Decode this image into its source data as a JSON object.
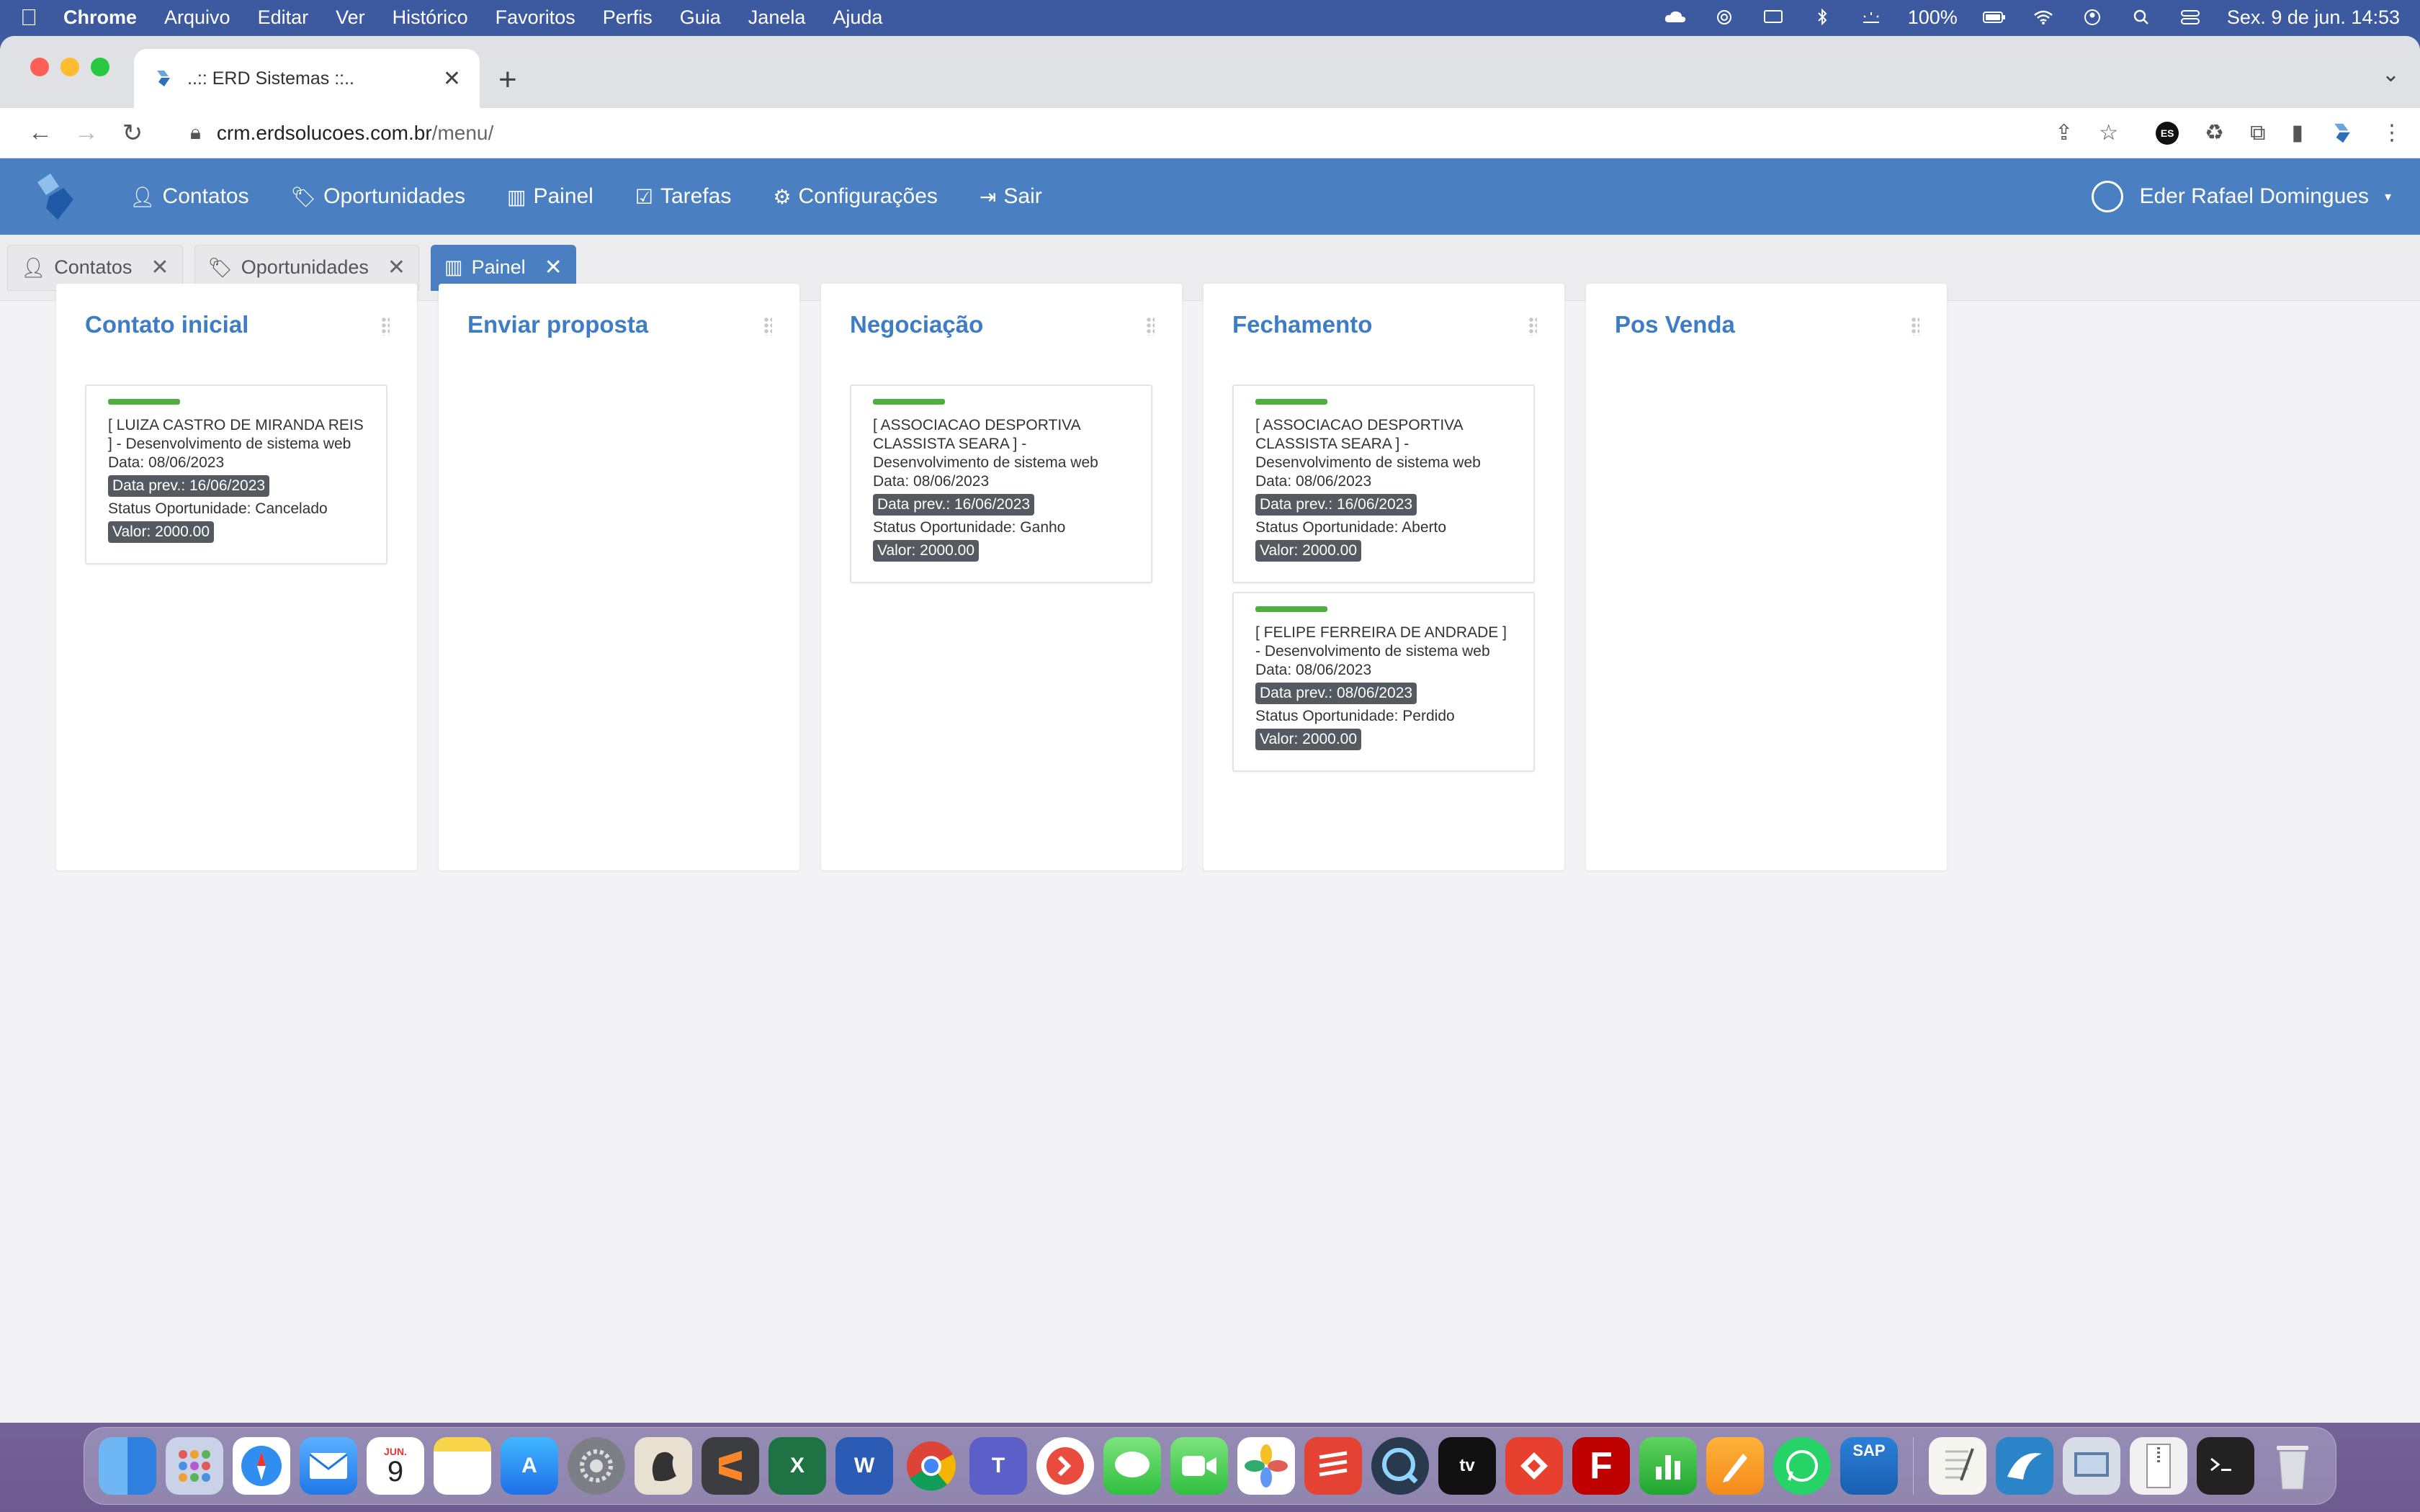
{
  "menubar": {
    "app_name": "Chrome",
    "items": [
      "Arquivo",
      "Editar",
      "Ver",
      "Histórico",
      "Favoritos",
      "Perfis",
      "Guia",
      "Janela",
      "Ajuda"
    ],
    "battery": "100%",
    "datetime": "Sex. 9 de jun.  14:53"
  },
  "browser": {
    "tab_title": "..:: ERD Sistemas ::..",
    "url_host": "crm.erdsolucoes.com.br",
    "url_path": "/menu/",
    "extension_es": "ES"
  },
  "app_nav": {
    "links": [
      "Contatos",
      "Oportunidades",
      "Painel",
      "Tarefas",
      "Configurações",
      "Sair"
    ],
    "user": "Eder Rafael Domingues"
  },
  "app_tabs": [
    {
      "label": "Contatos"
    },
    {
      "label": "Oportunidades"
    },
    {
      "label": "Painel"
    }
  ],
  "board": {
    "columns": [
      {
        "title": "Contato inicial",
        "cards": [
          {
            "title": "[ LUIZA CASTRO DE MIRANDA REIS ] - Desenvolvimento de sistema web",
            "date": "Data: 08/06/2023",
            "prev": "Data prev.: 16/06/2023",
            "status": "Status Oportunidade: Cancelado",
            "value": "Valor: 2000.00"
          }
        ]
      },
      {
        "title": "Enviar proposta",
        "cards": []
      },
      {
        "title": "Negociação",
        "cards": [
          {
            "title": "[ ASSOCIACAO DESPORTIVA CLASSISTA SEARA ] - Desenvolvimento de sistema web",
            "date": "Data: 08/06/2023",
            "prev": "Data prev.: 16/06/2023",
            "status": "Status Oportunidade: Ganho",
            "value": "Valor: 2000.00"
          }
        ]
      },
      {
        "title": "Fechamento",
        "cards": [
          {
            "title": "[ ASSOCIACAO DESPORTIVA CLASSISTA SEARA ] - Desenvolvimento de sistema web",
            "date": "Data: 08/06/2023",
            "prev": "Data prev.: 16/06/2023",
            "status": "Status Oportunidade: Aberto",
            "value": "Valor: 2000.00"
          },
          {
            "title": "[ FELIPE FERREIRA DE ANDRADE ] - Desenvolvimento de sistema web",
            "date": "Data: 08/06/2023",
            "prev": "Data prev.: 08/06/2023",
            "status": "Status Oportunidade: Perdido",
            "value": "Valor: 2000.00"
          }
        ]
      },
      {
        "title": "Pos Venda",
        "cards": []
      }
    ]
  },
  "dock": {
    "calendar_month": "JUN.",
    "calendar_day": "9",
    "apps": [
      "finder",
      "launchpad",
      "safari",
      "mail",
      "calendar",
      "notes",
      "app-store",
      "system-settings",
      "sequel",
      "sublime",
      "excel",
      "word",
      "chrome",
      "teams",
      "anydesk",
      "messages",
      "facetime",
      "photos",
      "todoist",
      "quicktime",
      "apple-tv",
      "anydesk-red",
      "filezilla",
      "numbers",
      "pages",
      "whatsapp",
      "sap",
      "textedit",
      "mysql-workbench",
      "preview",
      "archive",
      "terminal",
      "trash"
    ]
  },
  "colors": {
    "nav_blue": "#4a7fc1",
    "title_blue": "#3d7dc5",
    "progress_green": "#4fae3d"
  }
}
